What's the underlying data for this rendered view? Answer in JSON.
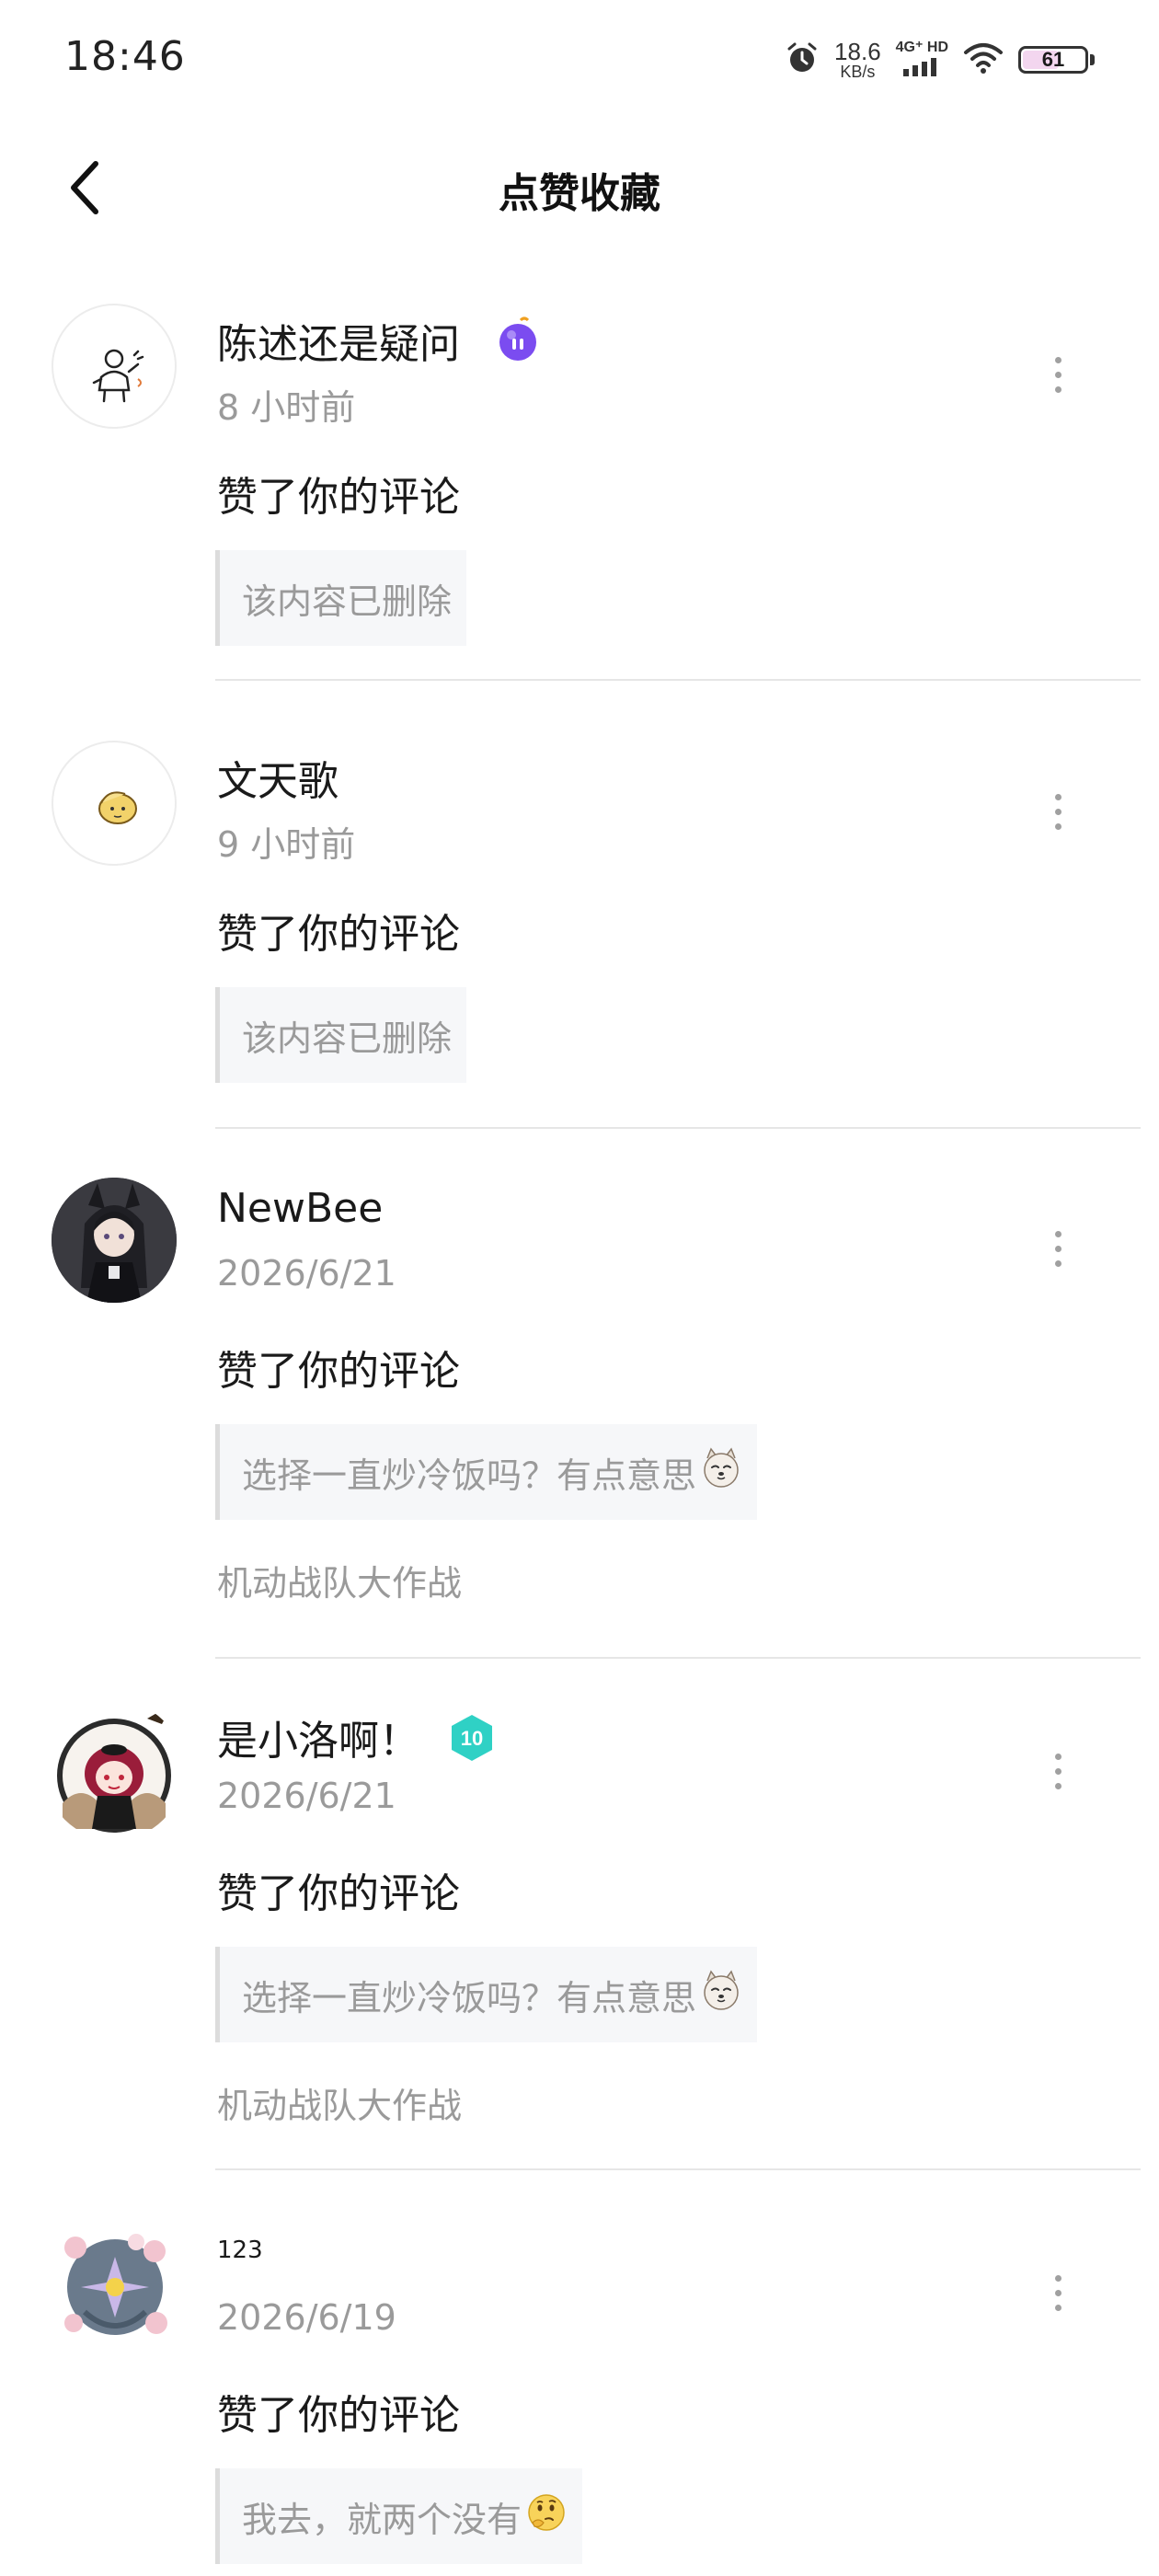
{
  "status": {
    "time": "18:46",
    "net_speed": "18.6",
    "net_unit": "KB/s",
    "signal_label": "4G⁺ HD",
    "battery": "61",
    "battery_level": 0.61,
    "icons": [
      "alarm-icon",
      "signal-icon",
      "wifi-icon",
      "battery-icon"
    ]
  },
  "header": {
    "title": "点赞收藏",
    "back_icon": "chevron-left-icon"
  },
  "notifications": [
    {
      "user": "陈述还是疑问",
      "badge": "purple-bomb-badge",
      "time": "8 小时前",
      "action": "赞了你的评论",
      "quote": "该内容已删除",
      "source": ""
    },
    {
      "user": "文天歌",
      "time": "9 小时前",
      "action": "赞了你的评论",
      "quote": "该内容已删除",
      "source": ""
    },
    {
      "user": "NewBee",
      "time": "2026/6/21",
      "action": "赞了你的评论",
      "quote": "选择一直炒冷饭吗？有点意思",
      "quote_emoji": "dog-face-emoji",
      "source": "机动战队大作战"
    },
    {
      "user": "是小洛啊！",
      "badge_text": "10",
      "time": "2026/6/21",
      "action": "赞了你的评论",
      "quote": "选择一直炒冷饭吗？有点意思",
      "quote_emoji": "dog-face-emoji",
      "source": "机动战队大作战"
    },
    {
      "user": "123",
      "time": "2026/6/19",
      "action": "赞了你的评论",
      "quote": "我去，就两个没有",
      "quote_emoji": "thinking-face-emoji",
      "source": ""
    }
  ],
  "colors": {
    "text_primary": "#1a1a1a",
    "text_secondary": "#9a9a9a",
    "badge_purple": "#7b4cf0",
    "badge_teal": "#2fd1c5",
    "quote_bg": "#f6f7f9"
  }
}
